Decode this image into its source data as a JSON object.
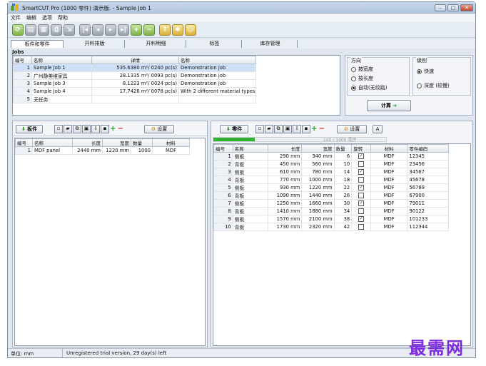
{
  "window": {
    "title": "SmartCUT Pro (1000 零件) 演示版. - Sample Job 1"
  },
  "menu": [
    "文件",
    "编辑",
    "选项",
    "帮助"
  ],
  "tabs": [
    "板件和零件",
    "开料排版",
    "开料明细",
    "标签",
    "库存管理"
  ],
  "jobs": {
    "label": "Jobs",
    "columns": [
      "编号",
      "名称",
      "详情",
      "名称"
    ],
    "rows": [
      {
        "id": "1",
        "name": "Sample Job 1",
        "detail": "535.6380 m²/ 0240 pc(s)",
        "desc": "Demonstration job"
      },
      {
        "id": "2",
        "name": "广州静美维家具",
        "detail": "28.1335 m²/ 0093 pc(s)",
        "desc": "Demonstration job"
      },
      {
        "id": "3",
        "name": "Sample Job 3",
        "detail": "8.1223 m²/ 0024 pc(s)",
        "desc": "Demonstration job"
      },
      {
        "id": "4",
        "name": "Sample Job 4",
        "detail": "17.7426 m²/ 0078 pc(s)",
        "desc": "With 2 different material types"
      },
      {
        "id": "5",
        "name": "无任务",
        "detail": "",
        "desc": ""
      }
    ]
  },
  "direction": {
    "title": "方向",
    "options": [
      "按宽度",
      "按长度",
      "自动(无纹路)"
    ],
    "selected": 2
  },
  "level": {
    "title": "级别",
    "options": [
      "快速",
      "深度 (较慢)"
    ],
    "selected": 0
  },
  "calc_button": "计算",
  "boards": {
    "title": "板件",
    "settings": "设置",
    "columns": [
      "编号",
      "名称",
      "长度",
      "宽度",
      "数量",
      "材料"
    ],
    "rows": [
      {
        "id": "1",
        "name": "MDF panel",
        "length": "2440 mm",
        "width": "1220 mm",
        "qty": "1000",
        "material": "MDF"
      }
    ]
  },
  "parts": {
    "title": "零件",
    "settings": "设置",
    "counter": "240 / 1000 零件",
    "progress": 0.24,
    "columns": [
      "编号",
      "名称",
      "长度",
      "宽度",
      "数量",
      "旋转",
      "材料",
      "零件编码"
    ],
    "rows": [
      {
        "id": "1",
        "name": "侧板",
        "length": "290 mm",
        "width": "340 mm",
        "qty": "6",
        "rot": true,
        "material": "MDF",
        "code": "12345"
      },
      {
        "id": "2",
        "name": "背板",
        "length": "450 mm",
        "width": "560 mm",
        "qty": "10",
        "rot": false,
        "material": "MDF",
        "code": "23456"
      },
      {
        "id": "3",
        "name": "侧板",
        "length": "610 mm",
        "width": "780 mm",
        "qty": "14",
        "rot": true,
        "material": "MDF",
        "code": "34567"
      },
      {
        "id": "4",
        "name": "背板",
        "length": "770 mm",
        "width": "1000 mm",
        "qty": "18",
        "rot": false,
        "material": "MDF",
        "code": "45678"
      },
      {
        "id": "5",
        "name": "侧板",
        "length": "930 mm",
        "width": "1220 mm",
        "qty": "22",
        "rot": true,
        "material": "MDF",
        "code": "56789"
      },
      {
        "id": "6",
        "name": "背板",
        "length": "1090 mm",
        "width": "1440 mm",
        "qty": "26",
        "rot": false,
        "material": "MDF",
        "code": "67900"
      },
      {
        "id": "7",
        "name": "侧板",
        "length": "1250 mm",
        "width": "1660 mm",
        "qty": "30",
        "rot": true,
        "material": "MDF",
        "code": "79011"
      },
      {
        "id": "8",
        "name": "背板",
        "length": "1410 mm",
        "width": "1880 mm",
        "qty": "34",
        "rot": false,
        "material": "MDF",
        "code": "90122"
      },
      {
        "id": "9",
        "name": "侧板",
        "length": "1570 mm",
        "width": "2100 mm",
        "qty": "38",
        "rot": true,
        "material": "MDF",
        "code": "101233"
      },
      {
        "id": "10",
        "name": "背板",
        "length": "1730 mm",
        "width": "2320 mm",
        "qty": "42",
        "rot": false,
        "material": "MDF",
        "code": "112344"
      }
    ]
  },
  "status": {
    "unit": "单位: mm",
    "message": "Unregistered trial version, 29 day(s) left"
  },
  "watermark": "最需网",
  "colors": {
    "accent": "#2a9a27",
    "selection": "#cde0f7",
    "watermark": "#7f2be0"
  }
}
